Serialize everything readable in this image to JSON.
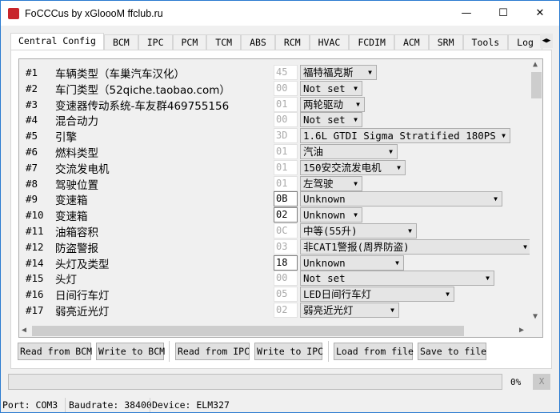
{
  "window": {
    "title": "FoCCCus by xGloooM ffclub.ru",
    "min": "—",
    "max": "☐",
    "close": "✕"
  },
  "tabs": [
    "Central Config",
    "BCM",
    "IPC",
    "PCM",
    "TCM",
    "ABS",
    "RCM",
    "HVAC",
    "FCDIM",
    "ACM",
    "SRM",
    "Tools",
    "Log"
  ],
  "rows": [
    {
      "num": "#1",
      "label": "车辆类型（车巢汽车汉化）",
      "hex": "45",
      "editable": false,
      "value": "福特福克斯"
    },
    {
      "num": "#2",
      "label": "车门类型（52qiche.taobao.com）",
      "hex": "00",
      "editable": false,
      "value": "Not set"
    },
    {
      "num": "#3",
      "label": "变速器传动系统-车友群469755156",
      "hex": "01",
      "editable": false,
      "value": "两轮驱动"
    },
    {
      "num": "#4",
      "label": "混合动力",
      "hex": "00",
      "editable": false,
      "value": "Not set"
    },
    {
      "num": "#5",
      "label": "引擎",
      "hex": "3D",
      "editable": false,
      "value": "1.6L GTDI Sigma Stratified 180PS"
    },
    {
      "num": "#6",
      "label": "燃料类型",
      "hex": "01",
      "editable": false,
      "value": "汽油"
    },
    {
      "num": "#7",
      "label": "交流发电机",
      "hex": "01",
      "editable": false,
      "value": "150安交流发电机"
    },
    {
      "num": "#8",
      "label": "驾驶位置",
      "hex": "01",
      "editable": false,
      "value": "左驾驶"
    },
    {
      "num": "#9",
      "label": "变速箱",
      "hex": "0B",
      "editable": true,
      "value": "Unknown"
    },
    {
      "num": "#10",
      "label": "变速箱",
      "hex": "02",
      "editable": true,
      "value": "Unknown"
    },
    {
      "num": "#11",
      "label": "油箱容积",
      "hex": "0C",
      "editable": false,
      "value": "中等(55升)"
    },
    {
      "num": "#12",
      "label": "防盗警报",
      "hex": "03",
      "editable": false,
      "value": "非CAT1警报(周界防盗)"
    },
    {
      "num": "#14",
      "label": "头灯及类型",
      "hex": "18",
      "editable": true,
      "value": "Unknown"
    },
    {
      "num": "#15",
      "label": "头灯",
      "hex": "00",
      "editable": false,
      "value": "Not set"
    },
    {
      "num": "#16",
      "label": "日间行车灯",
      "hex": "05",
      "editable": false,
      "value": "LED日间行车灯"
    },
    {
      "num": "#17",
      "label": "弱亮近光灯",
      "hex": "02",
      "editable": false,
      "value": "弱亮近光灯"
    }
  ],
  "buttons": {
    "read_bcm": "Read from BCM",
    "write_bcm": "Write to BCM",
    "read_ipc": "Read from IPC",
    "write_ipc": "Write to IPC",
    "load": "Load from file",
    "save": "Save to file"
  },
  "progress": {
    "value": 0,
    "label": "0%",
    "cancel": "X"
  },
  "status": {
    "port": "Port: COM3",
    "baud": "Baudrate: 38400",
    "device": "Device: ELM327"
  }
}
